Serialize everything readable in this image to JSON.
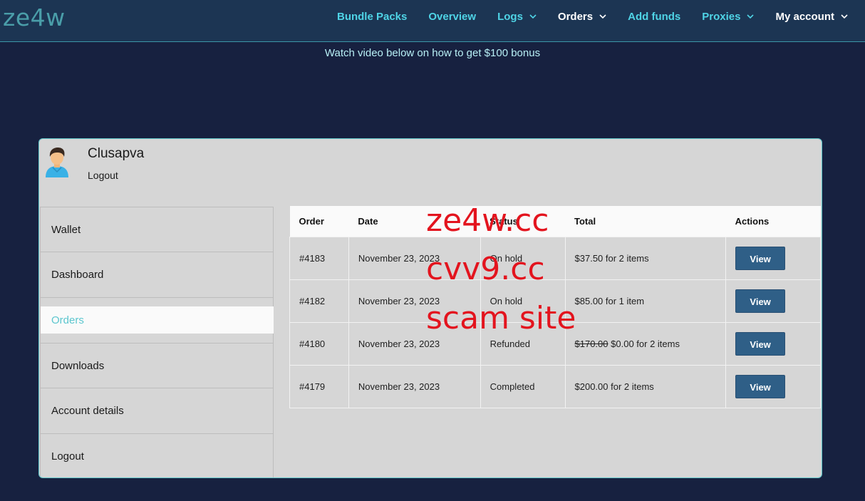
{
  "site": {
    "logo": "ze4w"
  },
  "nav": {
    "items": [
      {
        "label": "Bundle Packs",
        "dropdown": false
      },
      {
        "label": "Overview",
        "dropdown": false
      },
      {
        "label": "Logs",
        "dropdown": true
      },
      {
        "label": "Orders",
        "dropdown": true
      },
      {
        "label": "Add funds",
        "dropdown": false
      },
      {
        "label": "Proxies",
        "dropdown": true
      },
      {
        "label": "My account",
        "dropdown": true
      }
    ]
  },
  "promo": "Watch video below on how to get $100 bonus",
  "account": {
    "username": "Clusapva",
    "logout": "Logout"
  },
  "sidebar": {
    "items": [
      {
        "label": "Wallet"
      },
      {
        "label": "Dashboard"
      },
      {
        "label": "Orders",
        "active": true
      },
      {
        "label": "Downloads"
      },
      {
        "label": "Account details"
      },
      {
        "label": "Logout"
      }
    ]
  },
  "orders": {
    "headers": [
      "Order",
      "Date",
      "Status",
      "Total",
      "Actions"
    ],
    "rows": [
      {
        "order": "#4183",
        "date": "November 23, 2023",
        "status": "On hold",
        "total": "$37.50 for 2 items",
        "action": "View"
      },
      {
        "order": "#4182",
        "date": "November 23, 2023",
        "status": "On hold",
        "total": "$85.00 for 1 item",
        "action": "View"
      },
      {
        "order": "#4180",
        "date": "November 23, 2023",
        "status": "Refunded",
        "total_old": "$170.00",
        "total": "$0.00 for 2 items",
        "action": "View"
      },
      {
        "order": "#4179",
        "date": "November 23, 2023",
        "status": "Completed",
        "total": "$200.00 for 2 items",
        "action": "View"
      }
    ]
  },
  "watermark": {
    "line1": "ze4w.cc",
    "line2": "cvv9.cc",
    "line3": "scam site"
  },
  "colors": {
    "nav_bg": "#1c3553",
    "page_bg": "#172140",
    "accent": "#4fd4e6",
    "button": "#2f5f87",
    "watermark": "#e3141e"
  }
}
